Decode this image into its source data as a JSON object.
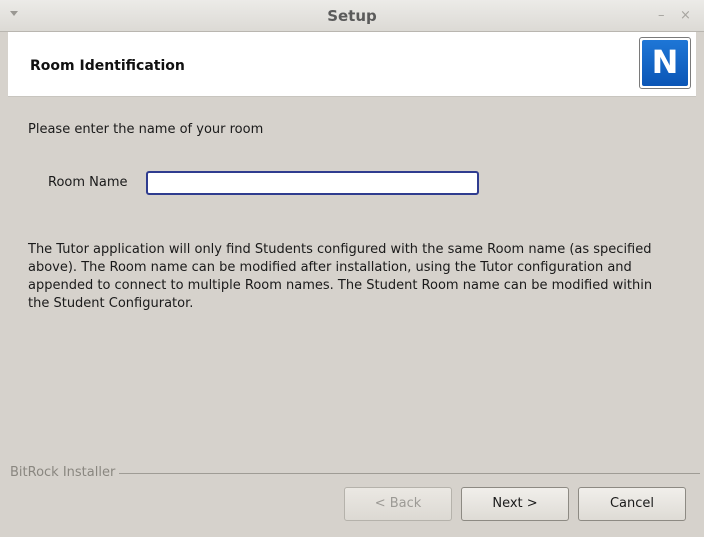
{
  "window": {
    "title": "Setup",
    "minimize_glyph": "–",
    "close_glyph": "×"
  },
  "header": {
    "title": "Room Identification",
    "logo_letter": "N"
  },
  "main": {
    "prompt": "Please enter the name of your room",
    "room_label": "Room Name",
    "room_value": "",
    "info_text": "The Tutor application will only find Students configured with the same Room name (as specified above).  The Room name can be modified after installation, using the Tutor configuration and appended to connect to multiple Room names.  The Student Room name can be modified within the Student Configurator."
  },
  "footer": {
    "installer_label": "BitRock Installer",
    "back_label": "< Back",
    "next_label": "Next >",
    "cancel_label": "Cancel"
  },
  "colors": {
    "logo_blue": "#0b56b6",
    "input_border": "#2f3c8f",
    "window_bg": "#d6d2cc"
  },
  "icons": [
    "window-menu-icon",
    "minimize-icon",
    "close-icon",
    "logo-icon"
  ]
}
